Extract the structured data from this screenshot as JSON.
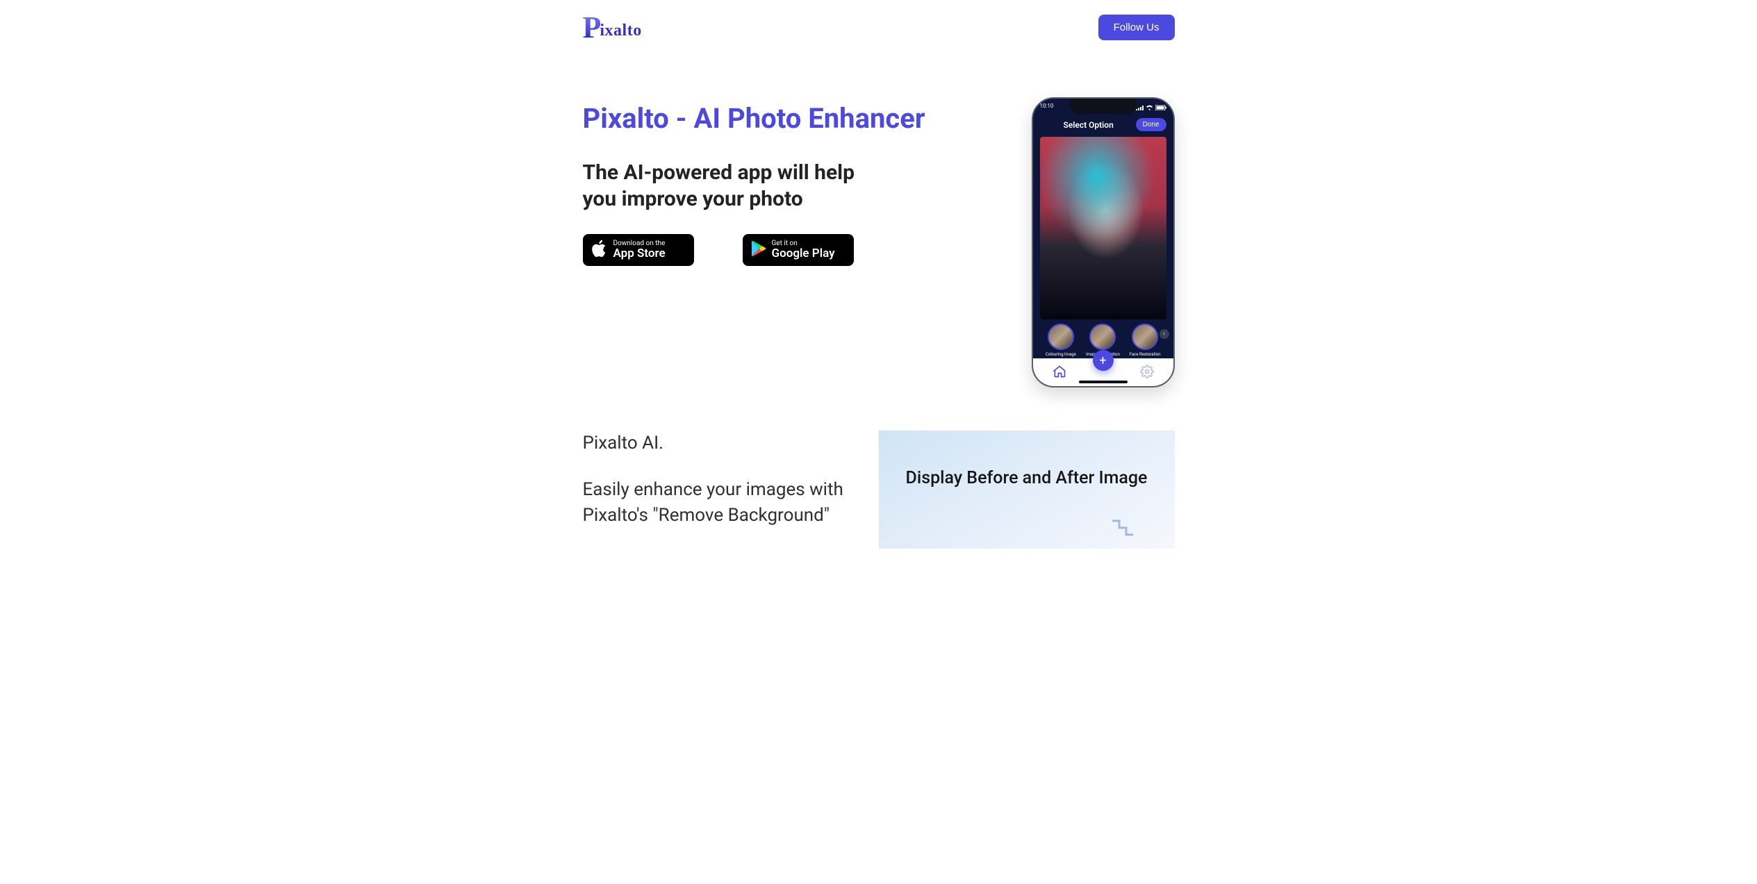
{
  "brand": {
    "letter": "P",
    "rest": "ixalto"
  },
  "nav": {
    "follow_label": "Follow Us"
  },
  "hero": {
    "title": "Pixalto - AI Photo Enhancer",
    "subtitle": "The AI-powered app will help you improve your photo"
  },
  "stores": {
    "apple_small": "Download on the",
    "apple_big": "App Store",
    "google_small": "Get it on",
    "google_big": "Google Play"
  },
  "phone": {
    "time": "10:10",
    "header_title": "Select Option",
    "done_label": "Done",
    "thumbs": [
      {
        "label": "Colouring Image"
      },
      {
        "label": "Image Restoration"
      },
      {
        "label": "Face Restoration"
      }
    ]
  },
  "section2": {
    "p1": "Pixalto AI.",
    "p2": "Easily enhance your images with Pixalto's \"Remove Background\"",
    "right_title": "Display Before and After Image"
  }
}
